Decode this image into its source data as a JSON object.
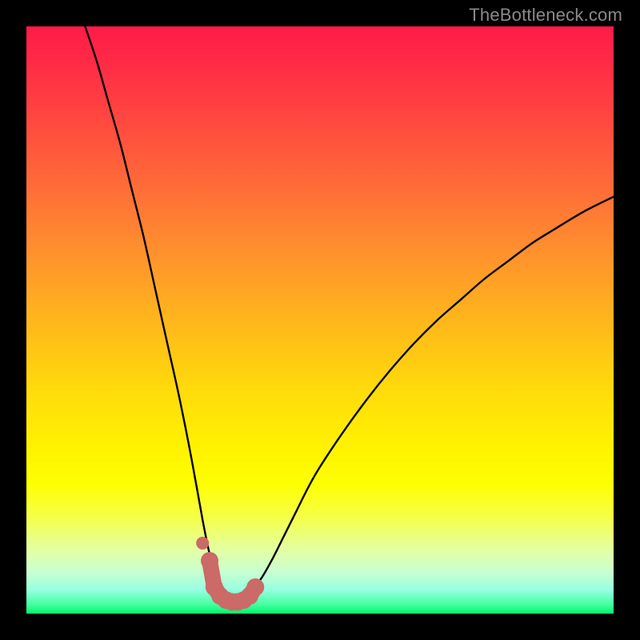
{
  "attribution": "TheBottleneck.com",
  "chart_data": {
    "type": "line",
    "title": "",
    "xlabel": "",
    "ylabel": "",
    "xlim": [
      0,
      100
    ],
    "ylim": [
      0,
      100
    ],
    "series": [
      {
        "name": "bottleneck-curve",
        "color": "#000000",
        "x": [
          10,
          12,
          14,
          16,
          18,
          20,
          22,
          24,
          26,
          28,
          30,
          31,
          32,
          33,
          34,
          35,
          36,
          37,
          38,
          40,
          42,
          44,
          46,
          48,
          50,
          54,
          58,
          62,
          66,
          70,
          74,
          78,
          82,
          86,
          90,
          95,
          100
        ],
        "y": [
          100,
          94,
          87,
          80,
          72,
          64,
          55,
          46,
          37,
          27,
          16,
          11,
          7,
          4,
          2.5,
          2,
          2,
          2.5,
          3.5,
          6,
          9.5,
          13.5,
          17.5,
          21.5,
          25,
          31,
          36.5,
          41.5,
          46,
          50,
          53.5,
          57,
          60,
          63,
          65.5,
          68.5,
          71
        ]
      },
      {
        "name": "highlight-marker",
        "color": "#cb6a67",
        "marker_type": "thick-dots",
        "x": [
          30.0,
          31.2,
          32.0,
          33.0,
          34.0,
          35.0,
          36.0,
          37.0,
          38.0,
          39.0
        ],
        "y": [
          12.0,
          9.0,
          4.5,
          3.0,
          2.3,
          2.0,
          2.0,
          2.3,
          3.0,
          4.5
        ]
      }
    ],
    "background_gradient": {
      "orientation": "vertical",
      "stops": [
        {
          "pos": 0.0,
          "color": "#ff1b49"
        },
        {
          "pos": 0.5,
          "color": "#ffb61c"
        },
        {
          "pos": 0.78,
          "color": "#feff02"
        },
        {
          "pos": 1.0,
          "color": "#00f56a"
        }
      ]
    }
  }
}
